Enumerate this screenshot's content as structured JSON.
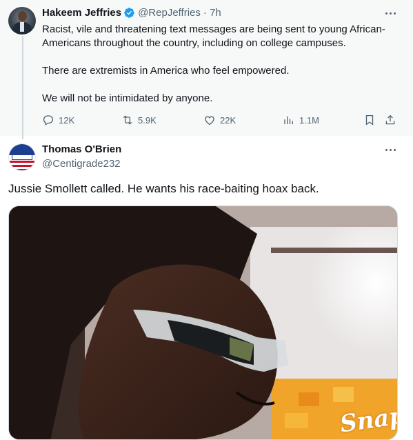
{
  "tweet1": {
    "author_name": "Hakeem Jeffries",
    "handle": "@RepJeffries",
    "time": "· 7h",
    "lines": [
      "Racist, vile and threatening text messages are being sent to young African-",
      "Americans throughout the country, including on college campuses.",
      "There are extremists in America who feel empowered.",
      "We will not be intimidated by anyone."
    ],
    "actions": {
      "replies": "12K",
      "reposts": "5.9K",
      "likes": "22K",
      "views": "1.1M"
    }
  },
  "tweet2": {
    "author_name": "Thomas O'Brien",
    "handle": "@Centigrade232",
    "text": "Jussie Smollett called. He wants his race-baiting hoax back.",
    "media_caption": "Snap"
  },
  "colors": {
    "verified": "#1d9bf0",
    "secondary_text": "#536471",
    "thread_line": "#cfd9de"
  },
  "icons": [
    "verified-badge-icon",
    "more-icon",
    "reply-icon",
    "repost-icon",
    "like-icon",
    "views-icon",
    "bookmark-icon",
    "share-icon"
  ]
}
